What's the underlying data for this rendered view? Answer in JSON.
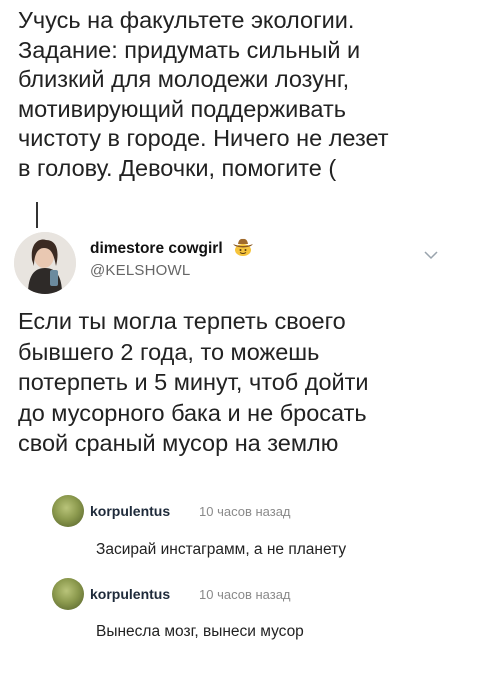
{
  "post": {
    "lines": [
      "Учусь на факультете экологии.",
      "Задание: придумать сильный и",
      "близкий для молодежи лозунг,",
      "мотивирующий поддерживать",
      "чистоту в городе. Ничего не лезет",
      "в голову. Девочки, помогите ("
    ]
  },
  "tweet": {
    "display_name": "dimestore cowgirl",
    "handle": "@KELSHOWL",
    "lines": [
      "Если ты могла терпеть своего",
      "бывшего 2 года, то можешь",
      "потерпеть и 5 минут, чтоб дойти",
      "до мусорного бака и не бросать",
      "свой сраный мусор на землю"
    ]
  },
  "comments": [
    {
      "user": "korpulentus",
      "time": "10 часов назад",
      "text": "Засирай инстаграмм, а не планету"
    },
    {
      "user": "korpulentus",
      "time": "10 часов назад",
      "text": "Вынесла мозг, вынеси мусор"
    }
  ],
  "icons": {
    "hat": "cowboy-hat-emoji",
    "chevron": "chevron-down-icon"
  }
}
